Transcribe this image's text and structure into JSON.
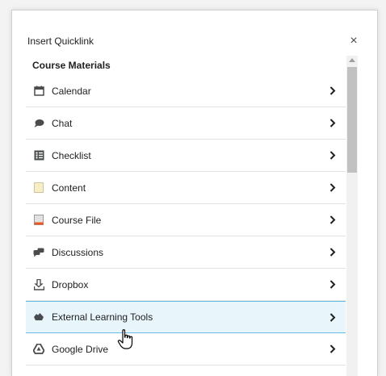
{
  "dialog": {
    "title": "Insert Quicklink",
    "close_label": "×",
    "section_title": "Course Materials"
  },
  "items": [
    {
      "label": "Calendar",
      "icon": "calendar-icon"
    },
    {
      "label": "Chat",
      "icon": "chat-icon"
    },
    {
      "label": "Checklist",
      "icon": "checklist-icon"
    },
    {
      "label": "Content",
      "icon": "content-icon"
    },
    {
      "label": "Course File",
      "icon": "course-file-icon"
    },
    {
      "label": "Discussions",
      "icon": "discussions-icon"
    },
    {
      "label": "Dropbox",
      "icon": "dropbox-icon"
    },
    {
      "label": "External Learning Tools",
      "icon": "external-tools-icon",
      "selected": true
    },
    {
      "label": "Google Drive",
      "icon": "google-drive-icon"
    }
  ],
  "colors": {
    "selected_bg": "#e8f6fb",
    "selected_border": "#66bde0",
    "text": "#202122",
    "icon": "#494c4e"
  }
}
